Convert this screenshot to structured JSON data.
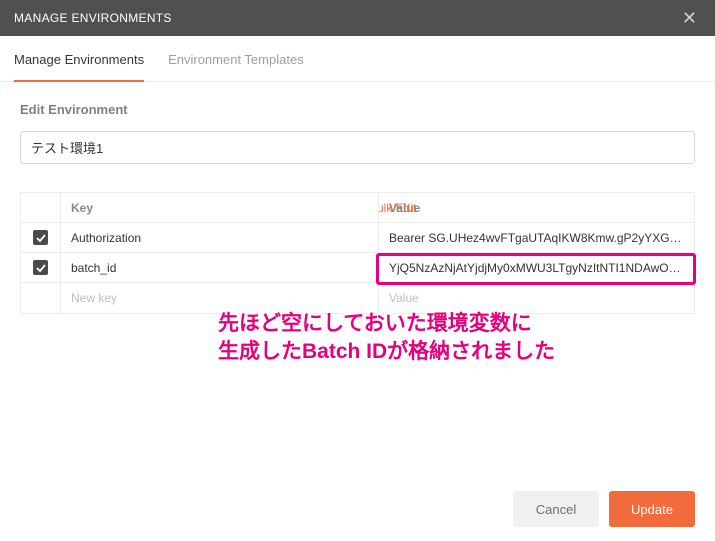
{
  "header": {
    "title": "MANAGE ENVIRONMENTS"
  },
  "tabs": {
    "manage": "Manage Environments",
    "templates": "Environment Templates"
  },
  "section": {
    "edit_env_title": "Edit Environment",
    "env_name_value": "テスト環境1"
  },
  "table": {
    "header_key": "Key",
    "header_value": "Value",
    "bulk_edit": "Bulk Edit",
    "rows": [
      {
        "key": "Authorization",
        "value": "Bearer SG.UHez4wvFTgaUTAqIKW8Kmw.gP2yYXG-y..."
      },
      {
        "key": "batch_id",
        "value": "YjQ5NzAzNjAtYjdjMy0xMWU3LTgyNzItNTI1NDAwOD..."
      }
    ],
    "new_key_placeholder": "New key",
    "new_value_placeholder": "Value"
  },
  "annotation": {
    "line1": "先ほど空にしておいた環境変数に",
    "line2": "生成したBatch IDが格納されました"
  },
  "footer": {
    "cancel": "Cancel",
    "update": "Update"
  },
  "colors": {
    "accent": "#f26b3a",
    "highlight": "#e6007e"
  }
}
